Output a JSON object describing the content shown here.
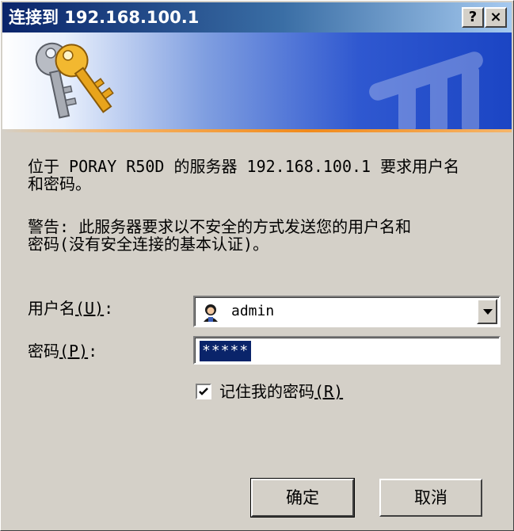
{
  "window": {
    "title": "连接到 192.168.100.1",
    "help_label": "?",
    "close_label": "×"
  },
  "message": {
    "prompt": "位于 PORAY R50D 的服务器 192.168.100.1 要求用户名\n和密码。",
    "warning": "警告: 此服务器要求以不安全的方式发送您的用户名和\n密码(没有安全连接的基本认证)。"
  },
  "form": {
    "username_label": "用户名",
    "username_hotkey": "(U)",
    "username_colon": ":",
    "username_value": "admin",
    "password_label": "密码",
    "password_hotkey": "(P)",
    "password_colon": ":",
    "password_value": "*****",
    "remember_label": "记住我的密码",
    "remember_hotkey": "(R)",
    "remember_checked": true
  },
  "buttons": {
    "ok_label": "确定",
    "cancel_label": "取消"
  },
  "icons": {
    "banner": "keys-icon",
    "user": "user-avatar-icon",
    "dropdown": "chevron-down-icon",
    "check": "checkmark-icon"
  },
  "colors": {
    "title_bar": "#0a246a",
    "face": "#d4d0c8",
    "selection": "#0a246a",
    "banner_orange": "#f08a1c"
  }
}
